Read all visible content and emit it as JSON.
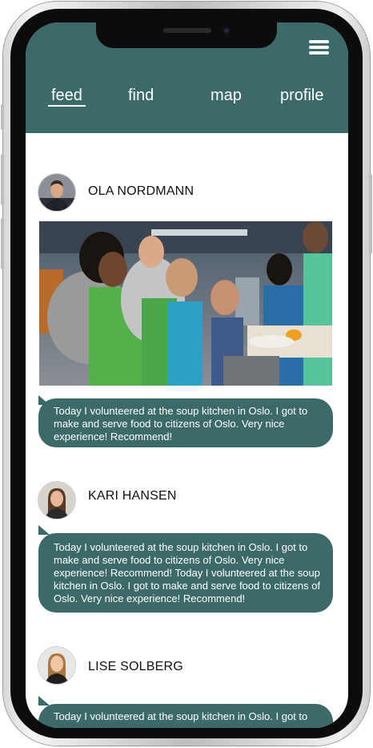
{
  "nav": {
    "tabs": [
      {
        "label": "feed",
        "active": true
      },
      {
        "label": "find",
        "active": false
      },
      {
        "label": "map",
        "active": false
      },
      {
        "label": "profile",
        "active": false
      }
    ],
    "menu_icon": "hamburger-menu-icon"
  },
  "posts": [
    {
      "author": "OLA NORDMANN",
      "has_photo": true,
      "text": "Today I volunteered at the soup kitchen in Oslo. I got to make and serve food to citizens of Oslo. Very nice experience! Recommend!"
    },
    {
      "author": "KARI HANSEN",
      "has_photo": false,
      "text": "Today I volunteered at the soup kitchen in Oslo. I got to make and serve food to citizens of Oslo. Very nice experience! Recommend! Today I volunteered at the soup kitchen in Oslo. I got to make and serve food to citizens of Oslo. Very nice experience! Recommend!"
    },
    {
      "author": "LISE SOLBERG",
      "has_photo": false,
      "text": "Today I volunteered at the soup kitchen in Oslo. I got to"
    }
  ],
  "colors": {
    "accent": "#3c6a69",
    "background": "#ffffff",
    "text_on_accent": "#ffffff"
  }
}
